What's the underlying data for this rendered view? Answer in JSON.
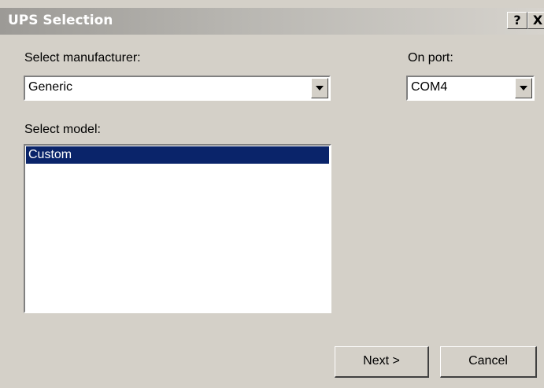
{
  "window": {
    "title": "UPS Selection",
    "help_label": "?",
    "close_label": "X"
  },
  "manufacturer": {
    "label": "Select manufacturer:",
    "value": "Generic"
  },
  "port": {
    "label": "On port:",
    "value": "COM4"
  },
  "model": {
    "label": "Select model:",
    "items": [
      {
        "label": "Custom",
        "selected": true
      }
    ]
  },
  "buttons": {
    "next_label": "Next >",
    "cancel_label": "Cancel"
  },
  "colors": {
    "dialog_bg": "#d4d0c8",
    "selection_bg": "#0a246a",
    "selection_text": "#ffffff"
  },
  "icons": [
    "help-icon",
    "close-icon",
    "chevron-down-icon"
  ]
}
